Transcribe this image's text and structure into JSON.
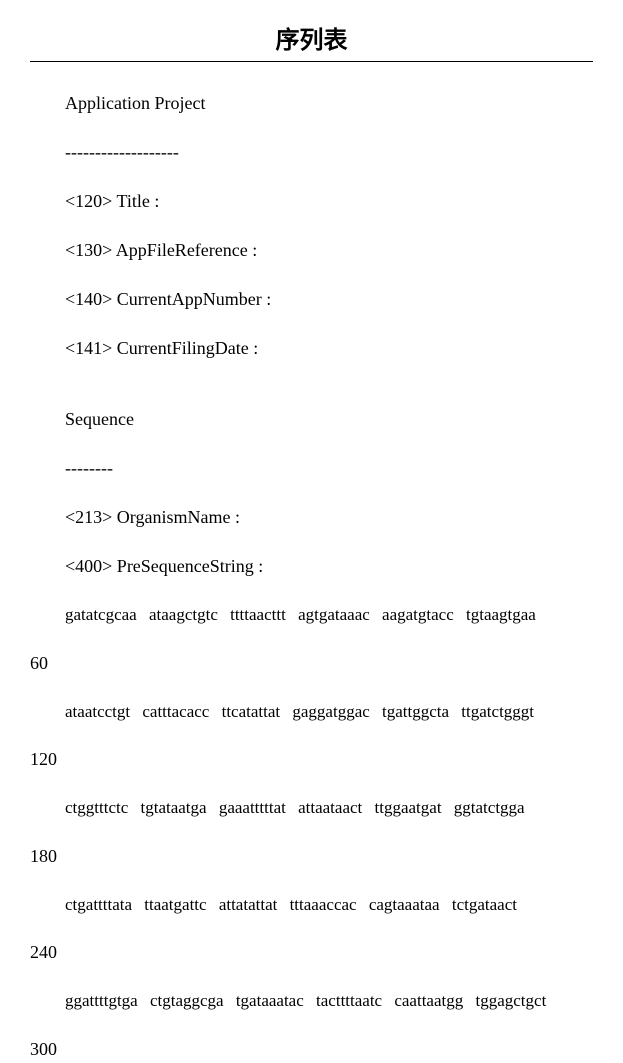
{
  "title": "序列表",
  "header": {
    "application_project": "Application Project",
    "dashes_long": "-------------------",
    "fields": [
      "<120> Title :",
      "<130> AppFileReference :",
      "<140> CurrentAppNumber :",
      "<141> CurrentFilingDate :"
    ]
  },
  "sequence_section": {
    "label": "Sequence",
    "dashes_short": "--------",
    "fields": [
      "<213> OrganismName :",
      "<400> PreSequenceString :"
    ]
  },
  "chart_data": {
    "type": "table",
    "title": "序列表",
    "rows": [
      {
        "position": 60,
        "blocks": [
          "gatatcgcaa",
          "ataagctgtc",
          "ttttaacttt",
          "agtgataaac",
          "aagatgtacc",
          "tgtaagtgaa"
        ]
      },
      {
        "position": 120,
        "blocks": [
          "ataatcctgt",
          "catttacacc",
          "ttcatattat",
          "gaggatggac",
          "tgattggcta",
          "ttgatctgggt"
        ]
      },
      {
        "position": 180,
        "blocks": [
          "ctggtttctc",
          "tgtataatga",
          "gaaatttttat",
          "attaataact",
          "ttggaatgat",
          "ggtatctgga"
        ]
      },
      {
        "position": 240,
        "blocks": [
          "ctgattttata",
          "ttaatgattc",
          "attatattat",
          "tttaaaccac",
          "cagtaaataa",
          "tctgataact"
        ]
      },
      {
        "position": 300,
        "blocks": [
          "ggattttgtga",
          "ctgtaggcga",
          "tgataaatac",
          "tacttttaatc",
          "caattaatgg",
          "tggagctgct"
        ]
      }
    ]
  }
}
